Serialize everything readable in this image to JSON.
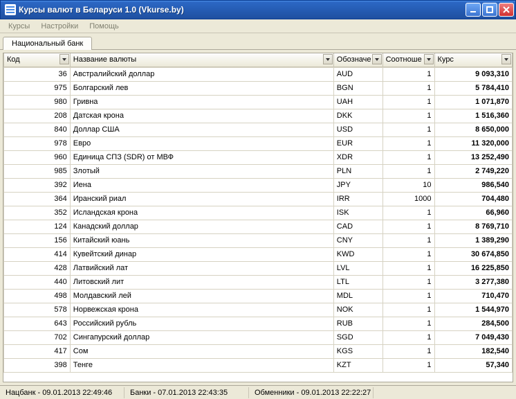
{
  "window": {
    "title": "Курсы валют в Беларуси 1.0 (Vkurse.by)"
  },
  "menu": {
    "items": [
      "Курсы",
      "Настройки",
      "Помощь"
    ]
  },
  "tabs": {
    "active": "Национальный банк"
  },
  "columns": {
    "code": "Код",
    "name": "Название валюты",
    "symbol": "Обозначе",
    "ratio": "Соотноше",
    "rate": "Курс"
  },
  "rows": [
    {
      "code": "36",
      "name": "Австралийский доллар",
      "symbol": "AUD",
      "ratio": "1",
      "rate": "9 093,310"
    },
    {
      "code": "975",
      "name": "Болгарский лев",
      "symbol": "BGN",
      "ratio": "1",
      "rate": "5 784,410"
    },
    {
      "code": "980",
      "name": "Гривна",
      "symbol": "UAH",
      "ratio": "1",
      "rate": "1 071,870"
    },
    {
      "code": "208",
      "name": "Датская крона",
      "symbol": "DKK",
      "ratio": "1",
      "rate": "1 516,360"
    },
    {
      "code": "840",
      "name": "Доллар США",
      "symbol": "USD",
      "ratio": "1",
      "rate": "8 650,000"
    },
    {
      "code": "978",
      "name": "Евро",
      "symbol": "EUR",
      "ratio": "1",
      "rate": "11 320,000"
    },
    {
      "code": "960",
      "name": "Единица СПЗ (SDR) от МВФ",
      "symbol": "XDR",
      "ratio": "1",
      "rate": "13 252,490"
    },
    {
      "code": "985",
      "name": "Злотый",
      "symbol": "PLN",
      "ratio": "1",
      "rate": "2 749,220"
    },
    {
      "code": "392",
      "name": "Иена",
      "symbol": "JPY",
      "ratio": "10",
      "rate": "986,540"
    },
    {
      "code": "364",
      "name": "Иранский риал",
      "symbol": "IRR",
      "ratio": "1000",
      "rate": "704,480"
    },
    {
      "code": "352",
      "name": "Исландская крона",
      "symbol": "ISK",
      "ratio": "1",
      "rate": "66,960"
    },
    {
      "code": "124",
      "name": "Канадский доллар",
      "symbol": "CAD",
      "ratio": "1",
      "rate": "8 769,710"
    },
    {
      "code": "156",
      "name": "Китайский юань",
      "symbol": "CNY",
      "ratio": "1",
      "rate": "1 389,290"
    },
    {
      "code": "414",
      "name": "Кувейтский динар",
      "symbol": "KWD",
      "ratio": "1",
      "rate": "30 674,850"
    },
    {
      "code": "428",
      "name": "Латвийский лат",
      "symbol": "LVL",
      "ratio": "1",
      "rate": "16 225,850"
    },
    {
      "code": "440",
      "name": "Литовский лит",
      "symbol": "LTL",
      "ratio": "1",
      "rate": "3 277,380"
    },
    {
      "code": "498",
      "name": "Молдавский лей",
      "symbol": "MDL",
      "ratio": "1",
      "rate": "710,470"
    },
    {
      "code": "578",
      "name": "Норвежская крона",
      "symbol": "NOK",
      "ratio": "1",
      "rate": "1 544,970"
    },
    {
      "code": "643",
      "name": "Российский рубль",
      "symbol": "RUB",
      "ratio": "1",
      "rate": "284,500"
    },
    {
      "code": "702",
      "name": "Сингапурский доллар",
      "symbol": "SGD",
      "ratio": "1",
      "rate": "7 049,430"
    },
    {
      "code": "417",
      "name": "Сом",
      "symbol": "KGS",
      "ratio": "1",
      "rate": "182,540"
    },
    {
      "code": "398",
      "name": "Тенге",
      "symbol": "KZT",
      "ratio": "1",
      "rate": "57,340"
    }
  ],
  "status": {
    "s1": "Нацбанк - 09.01.2013 22:49:46",
    "s2": "Банки - 07.01.2013 22:43:35",
    "s3": "Обменники - 09.01.2013 22:22:27"
  }
}
